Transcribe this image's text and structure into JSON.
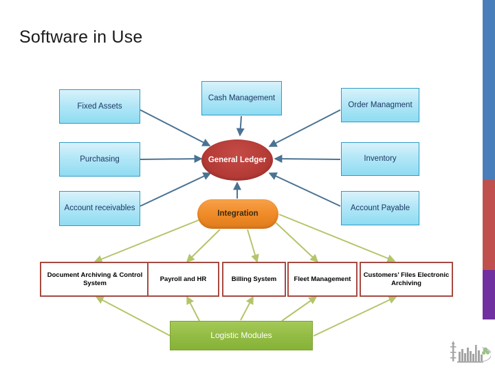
{
  "slide": {
    "title": "Software in Use",
    "background": "#ffffff"
  },
  "edge_stripe": {
    "blue": "#4a7ebb",
    "red": "#c0504d",
    "purple": "#7030a0"
  },
  "palette": {
    "blue_box_fill": "#a9e2f5",
    "blue_box_border": "#2e9ac4",
    "blue_box_text": "#1f3864",
    "ellipse_fill": "#b63c37",
    "ellipse_text": "#ffffff",
    "orange_fill": "#f08b28",
    "orange_text": "#3a2a10",
    "red_outline": "#a64941",
    "green_fill": "#92bb43",
    "blue_connector": "#4a7292",
    "green_connector": "#b3c56a"
  },
  "nodes": {
    "fixed_assets": "Fixed Assets",
    "purchasing": "Purchasing",
    "account_receivables": "Account receivables",
    "cash_management": "Cash Management",
    "order_management": "Order Managment",
    "inventory": "Inventory",
    "account_payable": "Account Payable",
    "general_ledger": "General Ledger",
    "integration": "Integration",
    "document_archiving": "Document Archiving & Control System",
    "payroll_hr": "Payroll and HR",
    "billing_system": "Billing System",
    "fleet_management": "Fleet Management",
    "customers_files": "Customers’ Files Electronic Archiving",
    "logistic_modules": "Logistic Modules"
  },
  "logo": {
    "alt": "refinery-plant-logo"
  },
  "chart_data": {
    "type": "diagram",
    "title": "Software in Use",
    "hubs": [
      {
        "id": "general_ledger",
        "label": "General Ledger",
        "shape": "ellipse",
        "color": "#b63c37"
      },
      {
        "id": "integration",
        "label": "Integration",
        "shape": "rounded-rect",
        "color": "#f08b28"
      },
      {
        "id": "logistic_modules",
        "label": "Logistic Modules",
        "shape": "rect",
        "color": "#92bb43"
      }
    ],
    "spokes_general_ledger": [
      "Fixed Assets",
      "Purchasing",
      "Account receivables",
      "Cash Management",
      "Order Managment",
      "Inventory",
      "Account Payable"
    ],
    "spokes_integration": [
      "Document Archiving & Control System",
      "Payroll and HR",
      "Billing System",
      "Fleet Management",
      "Customers’ Files Electronic Archiving"
    ],
    "spokes_logistic_modules": [
      "Document Archiving & Control System",
      "Payroll and HR",
      "Billing System",
      "Fleet Management",
      "Customers’ Files Electronic Archiving"
    ],
    "edges": [
      {
        "from": "Fixed Assets",
        "to": "General Ledger",
        "color": "#4a7292"
      },
      {
        "from": "Purchasing",
        "to": "General Ledger",
        "color": "#4a7292"
      },
      {
        "from": "Account receivables",
        "to": "General Ledger",
        "color": "#4a7292"
      },
      {
        "from": "Cash Management",
        "to": "General Ledger",
        "color": "#4a7292"
      },
      {
        "from": "Order Managment",
        "to": "General Ledger",
        "color": "#4a7292"
      },
      {
        "from": "Inventory",
        "to": "General Ledger",
        "color": "#4a7292"
      },
      {
        "from": "Account Payable",
        "to": "General Ledger",
        "color": "#4a7292"
      },
      {
        "from": "Integration",
        "to": "General Ledger",
        "color": "#4a7292"
      },
      {
        "from": "Integration",
        "to": "Document Archiving & Control System",
        "color": "#b3c56a"
      },
      {
        "from": "Integration",
        "to": "Payroll and HR",
        "color": "#b3c56a"
      },
      {
        "from": "Integration",
        "to": "Billing System",
        "color": "#b3c56a"
      },
      {
        "from": "Integration",
        "to": "Fleet Management",
        "color": "#b3c56a"
      },
      {
        "from": "Integration",
        "to": "Customers’ Files Electronic Archiving",
        "color": "#b3c56a"
      },
      {
        "from": "Logistic Modules",
        "to": "Document Archiving & Control System",
        "color": "#b3c56a"
      },
      {
        "from": "Logistic Modules",
        "to": "Payroll and HR",
        "color": "#b3c56a"
      },
      {
        "from": "Logistic Modules",
        "to": "Billing System",
        "color": "#b3c56a"
      },
      {
        "from": "Logistic Modules",
        "to": "Fleet Management",
        "color": "#b3c56a"
      },
      {
        "from": "Logistic Modules",
        "to": "Customers’ Files Electronic Archiving",
        "color": "#b3c56a"
      }
    ]
  }
}
